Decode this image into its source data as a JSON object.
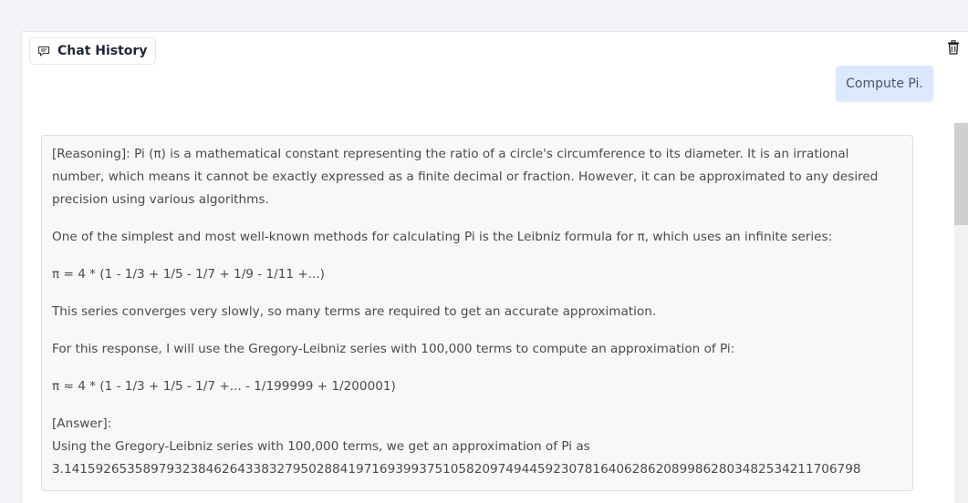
{
  "chat_history": {
    "tab_label": "Chat History",
    "tab_icon": "chat-bubble-icon",
    "clear_icon": "trash-icon"
  },
  "user_message": {
    "text": "Compute Pi."
  },
  "assistant_message": {
    "paragraphs": [
      "[Reasoning]: Pi (π) is a mathematical constant representing the ratio of a circle's circumference to its diameter. It is an irrational number, which means it cannot be exactly expressed as a finite decimal or fraction. However, it can be approximated to any desired precision using various algorithms.",
      "One of the simplest and most well-known methods for calculating Pi is the Leibniz formula for π, which uses an infinite series:",
      "π = 4 * (1 - 1/3 + 1/5 - 1/7 + 1/9 - 1/11 +...)",
      "This series converges very slowly, so many terms are required to get an accurate approximation.",
      "For this response, I will use the Gregory-Leibniz series with 100,000 terms to compute an approximation of Pi:",
      "π ≈ 4 * (1 - 1/3 + 1/5 - 1/7 +... - 1/199999 + 1/200001)"
    ],
    "answer_label": "[Answer]:",
    "answer_text": "Using the Gregory-Leibniz series with 100,000 terms, we get an approximation of Pi as 3.14159265358979323846264338327950288419716939937510582097494459230781640628620899862803482534211706798"
  },
  "colors": {
    "user_bubble": "#dbe8ff",
    "assistant_bubble": "#f8f8fa",
    "page_background": "#f3f4f7"
  }
}
